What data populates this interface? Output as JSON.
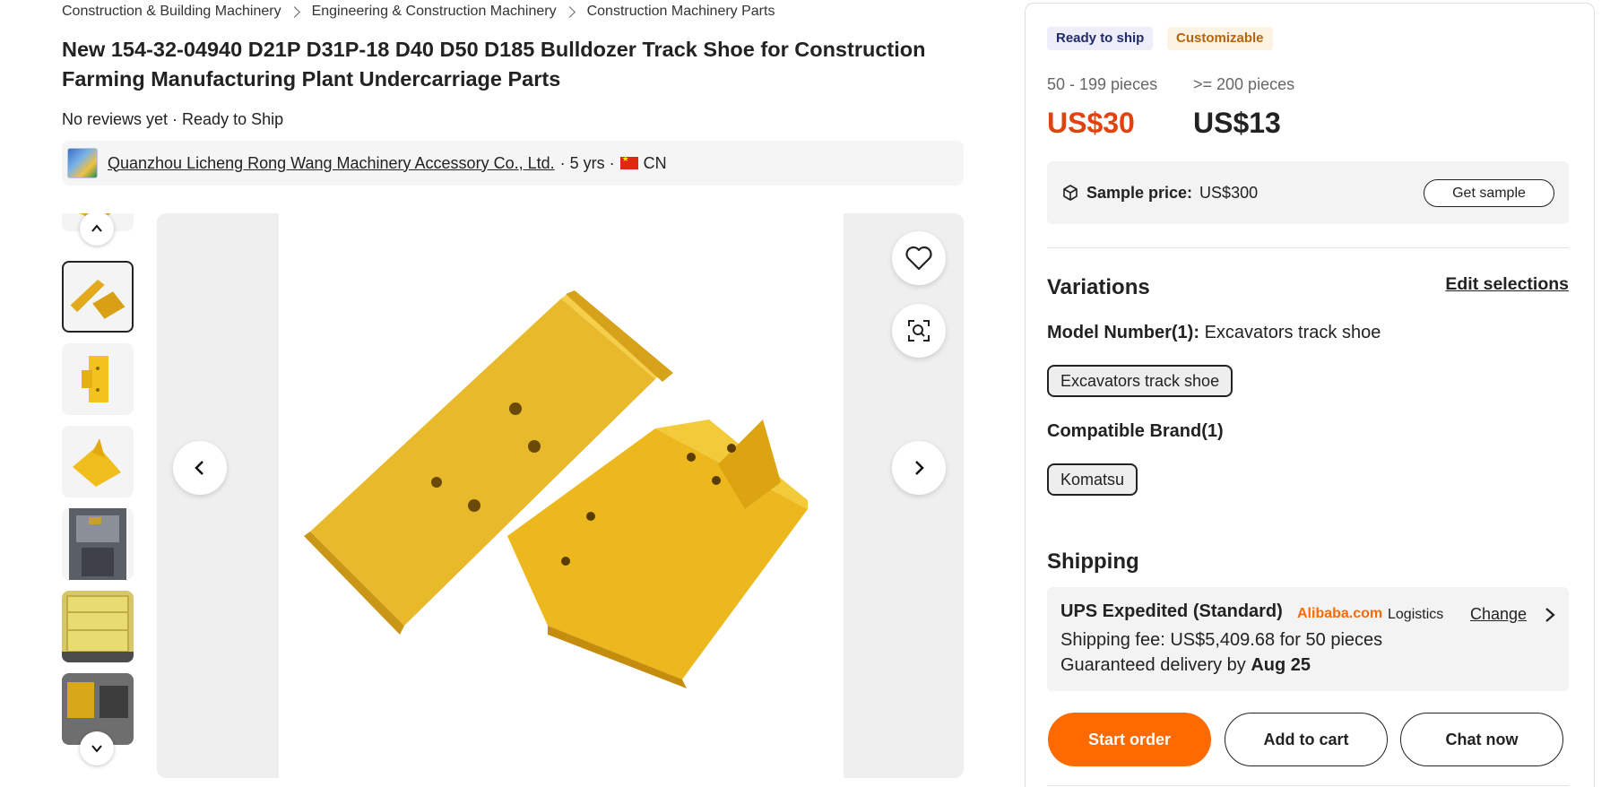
{
  "breadcrumb": [
    "Construction & Building Machinery",
    "Engineering & Construction Machinery",
    "Construction Machinery Parts"
  ],
  "product": {
    "title": "New 154-32-04940 D21P D31P-18 D40 D50 D185 Bulldozer Track Shoe for Construction Farming Manufacturing Plant Undercarriage Parts",
    "reviews": "No reviews yet · Ready to Ship"
  },
  "supplier": {
    "name": "Quanzhou Licheng Rong Wang Machinery Accessory Co., Ltd.",
    "years": "· 5 yrs ·",
    "country": "CN"
  },
  "gallery": {
    "thumbnails": [
      "track-shoe-partial",
      "track-shoe-pair",
      "track-shoe-single",
      "track-shoe-angled",
      "warehouse-container",
      "stacked-crate",
      "warehouse-stock"
    ],
    "selected_index": 1,
    "icons": [
      "chevron-up-icon",
      "chevron-down-icon",
      "chevron-left-icon",
      "chevron-right-icon",
      "heart-icon",
      "image-search-icon"
    ]
  },
  "badges": {
    "ready": "Ready to ship",
    "custom": "Customizable"
  },
  "pricing": {
    "tiers": [
      {
        "range": "50 - 199 pieces",
        "price": "US$30"
      },
      {
        "range": ">= 200 pieces",
        "price": "US$13"
      }
    ],
    "sample_label": "Sample price:",
    "sample_value": "US$300",
    "sample_button": "Get sample"
  },
  "variations": {
    "title": "Variations",
    "edit": "Edit selections",
    "model_label": "Model Number(1):",
    "model_value": "Excavators track shoe",
    "model_option": "Excavators track shoe",
    "brand_label": "Compatible Brand(1)",
    "brand_option": "Komatsu"
  },
  "shipping": {
    "title": "Shipping",
    "method": "UPS Expedited (Standard)",
    "logistics_brand": "Alibaba.com",
    "logistics_suffix": "Logistics",
    "change": "Change",
    "fee": "Shipping fee: US$5,409.68 for 50 pieces",
    "guarantee_prefix": "Guaranteed delivery by",
    "guarantee_date": "Aug 25"
  },
  "actions": {
    "start": "Start order",
    "cart": "Add to cart",
    "chat": "Chat now"
  },
  "colors": {
    "accent": "#ff6a00",
    "price_highlight": "#e0430d",
    "product_yellow": "#e8b320"
  }
}
